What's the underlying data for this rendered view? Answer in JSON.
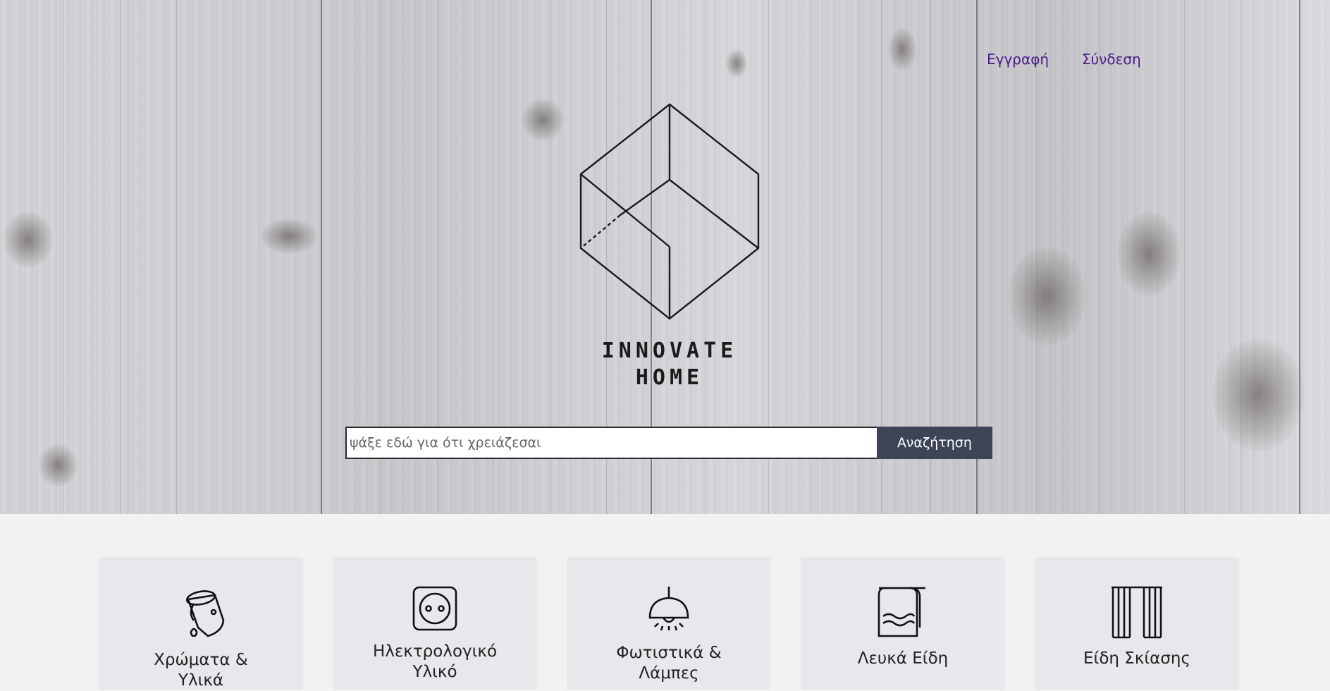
{
  "header": {
    "register_label": "Εγγραφή",
    "login_label": "Σύνδεση"
  },
  "logo": {
    "line1": "INNOVATE",
    "line2": "HOME"
  },
  "search": {
    "placeholder": "ψάξε εδώ για ότι χρειάζεσαι",
    "value": "",
    "button_label": "Αναζήτηση"
  },
  "categories": [
    {
      "label_line1": "Χρώματα &",
      "label_line2": "Υλικά",
      "icon": "paint-bucket-icon"
    },
    {
      "label_line1": "Ηλεκτρολογικό",
      "label_line2": "Υλικό",
      "icon": "power-socket-icon"
    },
    {
      "label_line1": "Φωτιστικά &",
      "label_line2": "Λάμπες",
      "icon": "ceiling-lamp-icon"
    },
    {
      "label_line1": "Λευκά Είδη",
      "label_line2": "",
      "icon": "towel-icon"
    },
    {
      "label_line1": "Είδη Σκίασης",
      "label_line2": "",
      "icon": "curtains-icon"
    }
  ],
  "colors": {
    "link": "#4b1a86",
    "search_button": "#3c4457",
    "card_bg": "#e8e8ec",
    "page_bg": "#f2f2f2"
  }
}
